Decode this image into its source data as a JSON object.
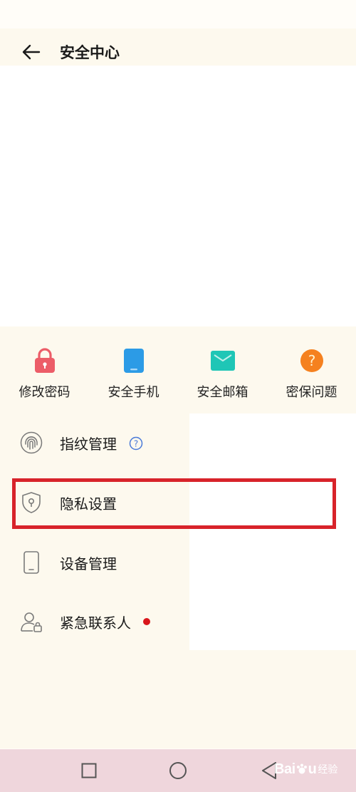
{
  "header": {
    "title": "安全中心",
    "back_icon": "arrow-left-icon"
  },
  "quick_actions": [
    {
      "label": "修改密码",
      "icon": "lock-icon",
      "color": "#ec5d68"
    },
    {
      "label": "安全手机",
      "icon": "phone-icon",
      "color": "#2c9be6"
    },
    {
      "label": "安全邮箱",
      "icon": "mail-icon",
      "color": "#1fc6b6"
    },
    {
      "label": "密保问题",
      "icon": "question-icon",
      "color": "#f5811f"
    }
  ],
  "list": [
    {
      "label": "指纹管理",
      "icon": "fingerprint-icon",
      "badge": "help-icon"
    },
    {
      "label": "隐私设置",
      "icon": "shield-icon",
      "highlighted": true
    },
    {
      "label": "设备管理",
      "icon": "device-icon"
    },
    {
      "label": "紧急联系人",
      "icon": "contact-icon",
      "badge": "red-dot"
    }
  ],
  "highlight_color": "#d8232a",
  "nav": {
    "recent_icon": "square-icon",
    "home_icon": "circle-icon",
    "back_icon": "triangle-back-icon"
  },
  "watermark": {
    "logo_text": "Bai",
    "logo_text_end": "u",
    "sub_text": "经验"
  }
}
